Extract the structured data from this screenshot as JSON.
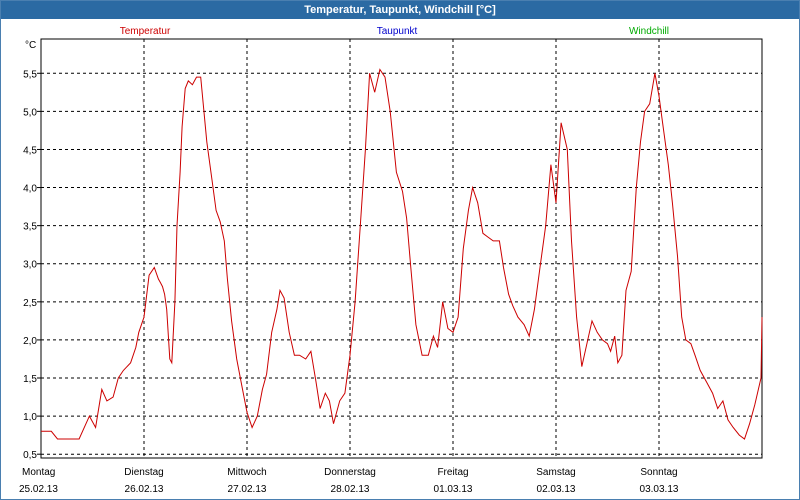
{
  "window": {
    "title": "Temperatur, Taupunkt, Windchill [°C]"
  },
  "legend": [
    {
      "name": "Temperatur",
      "color": "#cc0000"
    },
    {
      "name": "Taupunkt",
      "color": "#0000cc"
    },
    {
      "name": "Windchill",
      "color": "#00aa00"
    }
  ],
  "chart_data": {
    "type": "line",
    "title": "Temperatur, Taupunkt, Windchill [°C]",
    "ylabel": "°C",
    "ylim": [
      0.45,
      5.95
    ],
    "yticks": [
      "5,5",
      "5,0",
      "4,5",
      "4,0",
      "3,5",
      "3,0",
      "2,5",
      "2,0",
      "1,5",
      "1,0",
      "0,5"
    ],
    "yticks_values": [
      5.5,
      5.0,
      4.5,
      4.0,
      3.5,
      3.0,
      2.5,
      2.0,
      1.5,
      1.0,
      0.5
    ],
    "xlim": [
      0,
      7
    ],
    "xticks": [
      {
        "day": "Montag",
        "date": "25.02.13"
      },
      {
        "day": "Dienstag",
        "date": "26.02.13"
      },
      {
        "day": "Mittwoch",
        "date": "27.02.13"
      },
      {
        "day": "Donnerstag",
        "date": "28.02.13"
      },
      {
        "day": "Freitag",
        "date": "01.03.13"
      },
      {
        "day": "Samstag",
        "date": "02.03.13"
      },
      {
        "day": "Sonntag",
        "date": "03.03.13"
      }
    ],
    "grid": true,
    "series": [
      {
        "name": "Temperatur",
        "color": "#cc0000",
        "x": [
          0.0,
          0.1,
          0.16,
          0.22,
          0.28,
          0.37,
          0.47,
          0.53,
          0.59,
          0.64,
          0.7,
          0.75,
          0.8,
          0.87,
          0.92,
          0.95,
          1.0,
          1.05,
          1.1,
          1.14,
          1.16,
          1.18,
          1.2,
          1.22,
          1.25,
          1.27,
          1.3,
          1.32,
          1.35,
          1.37,
          1.4,
          1.43,
          1.47,
          1.51,
          1.55,
          1.61,
          1.66,
          1.7,
          1.74,
          1.78,
          1.81,
          1.85,
          1.9,
          1.95,
          2.0,
          2.05,
          2.1,
          2.15,
          2.19,
          2.24,
          2.29,
          2.32,
          2.36,
          2.41,
          2.46,
          2.51,
          2.57,
          2.62,
          2.67,
          2.71,
          2.76,
          2.8,
          2.84,
          2.9,
          2.95,
          3.0,
          3.05,
          3.1,
          3.15,
          3.19,
          3.24,
          3.29,
          3.34,
          3.39,
          3.45,
          3.51,
          3.55,
          3.59,
          3.64,
          3.7,
          3.76,
          3.81,
          3.85,
          3.9,
          3.95,
          4.0,
          4.05,
          4.1,
          4.15,
          4.19,
          4.24,
          4.29,
          4.34,
          4.39,
          4.45,
          4.49,
          4.54,
          4.58,
          4.63,
          4.69,
          4.74,
          4.79,
          4.85,
          4.9,
          4.95,
          5.0,
          5.05,
          5.11,
          5.15,
          5.2,
          5.25,
          5.3,
          5.35,
          5.4,
          5.45,
          5.5,
          5.53,
          5.57,
          5.6,
          5.64,
          5.68,
          5.73,
          5.78,
          5.82,
          5.86,
          5.91,
          5.96,
          6.0,
          6.04,
          6.09,
          6.13,
          6.18,
          6.22,
          6.26,
          6.31,
          6.35,
          6.4,
          6.46,
          6.52,
          6.57,
          6.62,
          6.67,
          6.72,
          6.78,
          6.83,
          6.88,
          6.93,
          6.99,
          7.0
        ],
        "values": [
          0.8,
          0.8,
          0.7,
          0.7,
          0.7,
          0.7,
          1.0,
          0.85,
          1.35,
          1.2,
          1.25,
          1.5,
          1.6,
          1.7,
          1.9,
          2.1,
          2.3,
          2.85,
          2.95,
          2.8,
          2.75,
          2.7,
          2.6,
          2.4,
          1.75,
          1.7,
          2.5,
          3.5,
          4.2,
          4.8,
          5.3,
          5.4,
          5.35,
          5.45,
          5.45,
          4.6,
          4.1,
          3.7,
          3.55,
          3.3,
          2.8,
          2.25,
          1.75,
          1.4,
          1.05,
          0.85,
          1.0,
          1.35,
          1.55,
          2.1,
          2.4,
          2.65,
          2.55,
          2.1,
          1.8,
          1.8,
          1.75,
          1.85,
          1.45,
          1.1,
          1.3,
          1.2,
          0.9,
          1.2,
          1.3,
          1.8,
          2.5,
          3.5,
          4.5,
          5.5,
          5.25,
          5.55,
          5.45,
          5.0,
          4.2,
          3.95,
          3.6,
          2.95,
          2.2,
          1.8,
          1.8,
          2.05,
          1.9,
          2.5,
          2.15,
          2.1,
          2.3,
          3.2,
          3.7,
          4.0,
          3.8,
          3.4,
          3.35,
          3.3,
          3.3,
          2.95,
          2.6,
          2.45,
          2.3,
          2.2,
          2.05,
          2.4,
          3.0,
          3.5,
          4.3,
          3.8,
          4.85,
          4.5,
          3.3,
          2.3,
          1.65,
          1.95,
          2.25,
          2.1,
          2.0,
          1.95,
          1.85,
          2.05,
          1.7,
          1.8,
          2.65,
          2.9,
          4.0,
          4.6,
          5.0,
          5.1,
          5.5,
          5.2,
          4.8,
          4.3,
          3.8,
          3.1,
          2.3,
          2.0,
          1.95,
          1.8,
          1.6,
          1.45,
          1.3,
          1.1,
          1.2,
          0.95,
          0.85,
          0.75,
          0.7,
          0.9,
          1.15,
          1.5,
          2.3
        ]
      }
    ]
  }
}
